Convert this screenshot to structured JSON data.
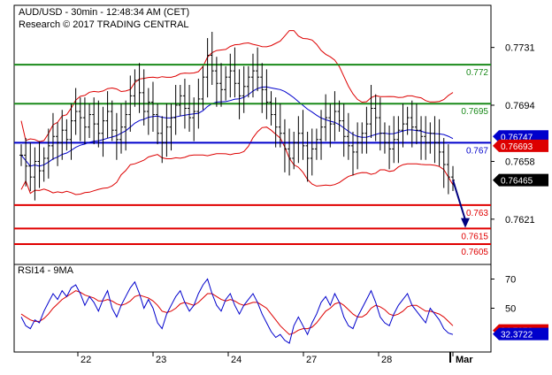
{
  "header": {
    "title": "AUD/USD - 30min - 12:48:34 AM (CET)",
    "research": "Research © 2017 TRADING CENTRAL"
  },
  "indicator": {
    "label": "RSI14 - 9MA"
  },
  "colors": {
    "support": "#e00000",
    "resistance": "#1a8a1a",
    "pivot": "#0000cc",
    "price_tag": "#000080",
    "bollinger": "#dd0000",
    "ma": "#0000cc",
    "candle": "#000000"
  },
  "chart_data": [
    {
      "type": "line",
      "name": "price",
      "x_ticks": [
        "22",
        "23",
        "24",
        "27",
        "28",
        "Mar"
      ],
      "y_ticks": [
        "0.7731",
        "0.7694",
        "0.7658",
        "0.7621"
      ],
      "ylim": [
        0.7592,
        0.7758
      ],
      "levels": [
        {
          "value": 0.772,
          "label": "0.772",
          "kind": "resistance"
        },
        {
          "value": 0.7695,
          "label": "0.7695",
          "kind": "resistance"
        },
        {
          "value": 0.767,
          "label": "0.767",
          "kind": "pivot"
        },
        {
          "value": 0.763,
          "label": "0.763",
          "kind": "support"
        },
        {
          "value": 0.7615,
          "label": "0.7615",
          "kind": "support"
        },
        {
          "value": 0.7605,
          "label": "0.7605",
          "kind": "support"
        }
      ],
      "price_tags": [
        {
          "value": 0.7674,
          "label": "0.76747",
          "color": "#0000cc"
        },
        {
          "value": 0.7668,
          "label": "0.76693",
          "color": "#dd0000"
        },
        {
          "value": 0.7646,
          "label": "0.76465",
          "color": "#000000"
        }
      ],
      "close": [
        0.7662,
        0.7655,
        0.7648,
        0.7658,
        0.7652,
        0.766,
        0.7668,
        0.7674,
        0.767,
        0.7678,
        0.7672,
        0.7684,
        0.769,
        0.7686,
        0.768,
        0.7688,
        0.7682,
        0.7676,
        0.7684,
        0.769,
        0.7678,
        0.7672,
        0.768,
        0.7688,
        0.77,
        0.771,
        0.7702,
        0.769,
        0.7696,
        0.7688,
        0.7676,
        0.767,
        0.768,
        0.7686,
        0.7694,
        0.77,
        0.7692,
        0.7686,
        0.769,
        0.7698,
        0.7712,
        0.7726,
        0.7716,
        0.7708,
        0.7704,
        0.7712,
        0.7716,
        0.7708,
        0.77,
        0.7706,
        0.7712,
        0.7716,
        0.7712,
        0.7704,
        0.7696,
        0.7688,
        0.768,
        0.7676,
        0.7666,
        0.766,
        0.767,
        0.7676,
        0.7668,
        0.766,
        0.7666,
        0.7672,
        0.768,
        0.7686,
        0.7682,
        0.769,
        0.7684,
        0.7674,
        0.7668,
        0.7664,
        0.767,
        0.7676,
        0.7682,
        0.7692,
        0.7686,
        0.7676,
        0.767,
        0.7666,
        0.7672,
        0.7678,
        0.7682,
        0.7686,
        0.768,
        0.7678,
        0.7674,
        0.767,
        0.7676,
        0.767,
        0.7664,
        0.7656,
        0.7648,
        0.7646
      ],
      "projection": {
        "from": 0.7646,
        "to": 0.7616
      }
    },
    {
      "type": "line",
      "name": "RSI14 - 9MA",
      "y_ticks": [
        "70",
        "50"
      ],
      "ylim": [
        20,
        80
      ],
      "rsi_tags": [
        {
          "value": 34.8,
          "label": "34.7978",
          "color": "#dd0000"
        },
        {
          "value": 32.37,
          "label": "32.3722",
          "color": "#0000cc"
        }
      ],
      "rsi": [
        44,
        38,
        36,
        42,
        40,
        48,
        54,
        60,
        56,
        62,
        58,
        64,
        66,
        60,
        52,
        58,
        54,
        48,
        56,
        62,
        50,
        44,
        52,
        58,
        64,
        68,
        60,
        50,
        56,
        50,
        40,
        36,
        46,
        52,
        58,
        62,
        54,
        48,
        52,
        60,
        66,
        70,
        60,
        52,
        48,
        56,
        60,
        52,
        46,
        52,
        56,
        60,
        54,
        46,
        40,
        34,
        30,
        32,
        28,
        26,
        38,
        44,
        38,
        32,
        40,
        46,
        54,
        58,
        52,
        60,
        54,
        44,
        38,
        36,
        44,
        50,
        56,
        62,
        54,
        44,
        40,
        38,
        46,
        52,
        56,
        60,
        52,
        48,
        44,
        40,
        50,
        46,
        42,
        36,
        33,
        32
      ],
      "rsi_ma": [
        46,
        44,
        42,
        41,
        41,
        43,
        46,
        50,
        53,
        56,
        58,
        60,
        62,
        61,
        59,
        58,
        57,
        55,
        55,
        56,
        55,
        53,
        52,
        53,
        55,
        58,
        59,
        58,
        57,
        55,
        52,
        48,
        47,
        48,
        50,
        53,
        54,
        53,
        52,
        54,
        57,
        60,
        60,
        58,
        56,
        55,
        56,
        55,
        53,
        52,
        53,
        54,
        54,
        52,
        50,
        46,
        42,
        38,
        35,
        32,
        33,
        35,
        36,
        36,
        37,
        40,
        44,
        48,
        50,
        53,
        54,
        52,
        49,
        46,
        44,
        44,
        46,
        50,
        52,
        51,
        49,
        46,
        45,
        46,
        48,
        51,
        52,
        52,
        50,
        48,
        48,
        47,
        46,
        44,
        41,
        38
      ]
    }
  ]
}
